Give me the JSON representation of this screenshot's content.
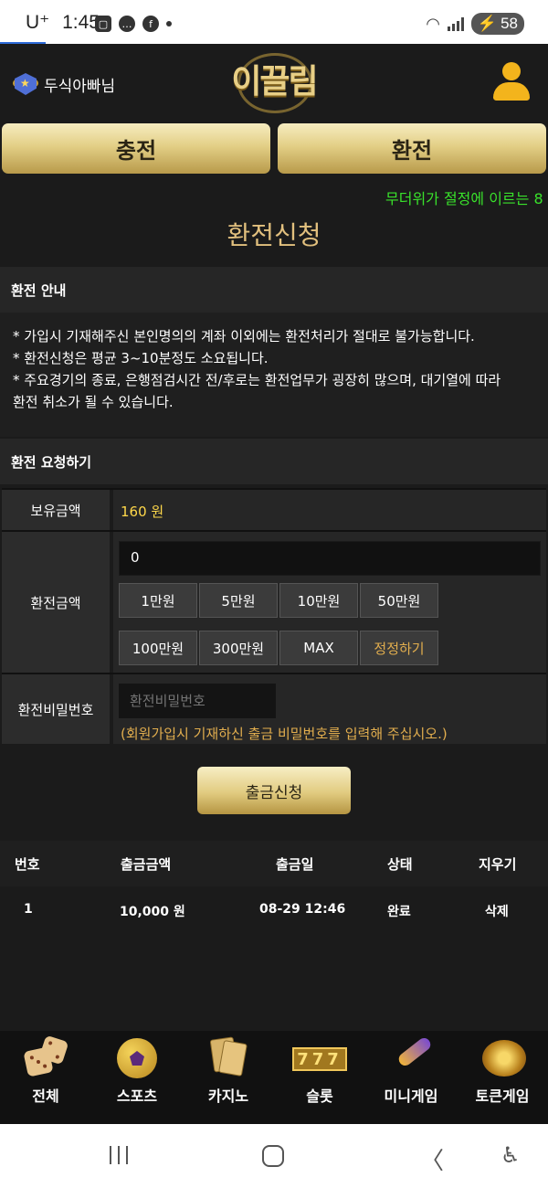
{
  "status_bar": {
    "carrier": "U⁺",
    "time": "1:45",
    "battery": "58"
  },
  "header": {
    "username": "두식아빠님",
    "logo_text": "이끌림"
  },
  "top_buttons": {
    "charge": "충전",
    "exchange": "환전"
  },
  "marquee": "무더위가 절정에 이르는 8",
  "page_title": "환전신청",
  "info": {
    "heading": "환전 안내",
    "lines": [
      "* 가입시 기재해주신 본인명의의 계좌 이외에는 환전처리가 절대로 불가능합니다.",
      "* 환전신청은 평균 3~10분정도 소요됩니다.",
      "* 주요경기의 종료, 은행점검시간 전/후로는 환전업무가 굉장히 많으며, 대기열에 따라",
      "환전 취소가 될 수 있습니다."
    ]
  },
  "request": {
    "heading": "환전 요청하기",
    "balance_label": "보유금액",
    "balance_value": "160 원",
    "amount_label": "환전금액",
    "amount_value": "0",
    "chips": [
      "1만원",
      "5만원",
      "10만원",
      "50만원",
      "100만원",
      "300만원",
      "MAX",
      "정정하기"
    ],
    "password_label": "환전비밀번호",
    "password_placeholder": "환전비밀번호",
    "password_note": "(회원가입시 기재하신 출금 비밀번호를 입력해 주십시오.)",
    "submit": "출금신청"
  },
  "history": {
    "columns": [
      "번호",
      "출금금액",
      "출금일",
      "상태",
      "지우기"
    ],
    "rows": [
      {
        "no": "1",
        "amount": "10,000 원",
        "date": "08-29 12:46",
        "status": "완료",
        "delete": "삭제"
      }
    ]
  },
  "bottom_nav": [
    {
      "label": "전체",
      "icon": "dice-icon"
    },
    {
      "label": "스포츠",
      "icon": "soccer-ball-icon"
    },
    {
      "label": "카지노",
      "icon": "cards-icon"
    },
    {
      "label": "슬롯",
      "icon": "slot-machine-icon"
    },
    {
      "label": "미니게임",
      "icon": "rocket-icon"
    },
    {
      "label": "토큰게임",
      "icon": "roulette-icon"
    }
  ],
  "slot_icon_text": "777",
  "colors": {
    "gold_button": "#e3cf86",
    "title_gold": "#e2c07e",
    "balance_yellow": "#ffd84a",
    "note_orange": "#e2ae4e",
    "marquee_green": "#39e22b",
    "background": "#1b1b1b"
  }
}
